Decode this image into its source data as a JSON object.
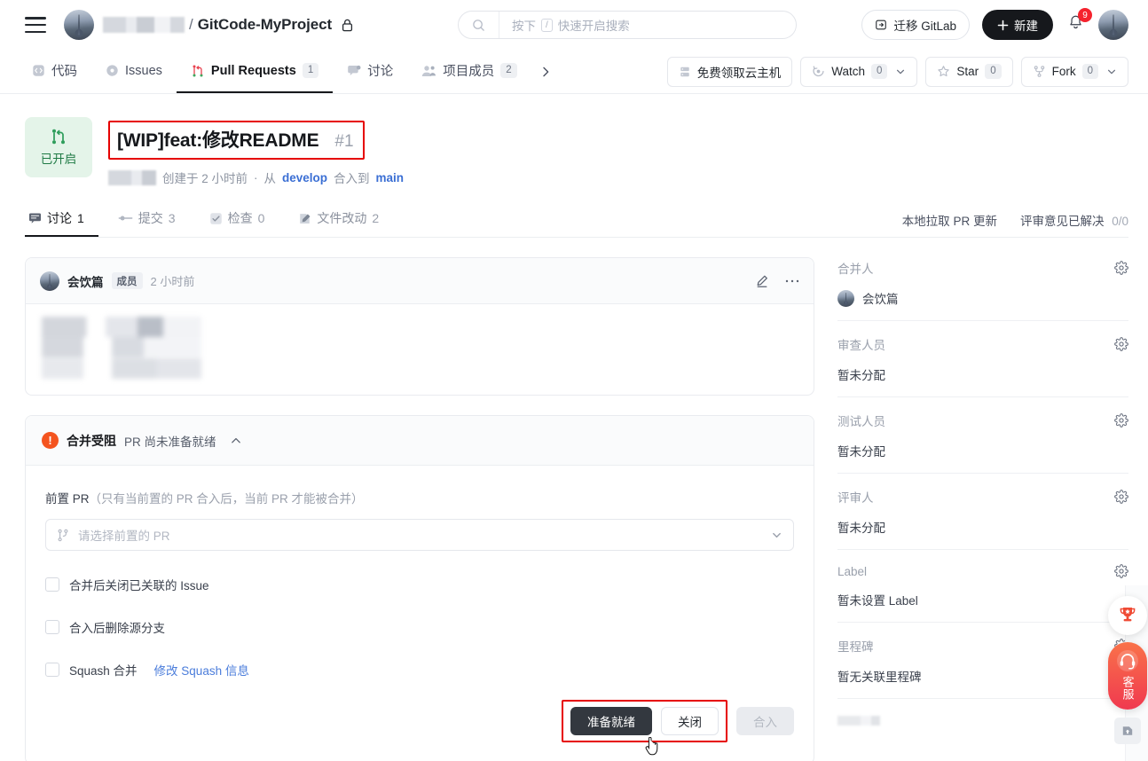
{
  "header": {
    "org_name_redacted": true,
    "repo_separator": "/",
    "repo_name": "GitCode-MyProject",
    "lock_icon": "lock-icon",
    "search": {
      "placeholder_prefix": "按下",
      "slash_key": "/",
      "placeholder_suffix": "快速开启搜索",
      "icon": "search-icon"
    },
    "migrate_gitlab_label": "迁移 GitLab",
    "new_button_label": "新建",
    "notification_count": "9",
    "avatar": "user-avatar"
  },
  "repo_nav": {
    "tabs": [
      {
        "label": "代码",
        "icon": "code-icon",
        "count": "",
        "active": false
      },
      {
        "label": "Issues",
        "icon": "issue-icon",
        "count": "",
        "active": false
      },
      {
        "label": "Pull Requests",
        "icon": "pull-request-icon",
        "count": "1",
        "active": true
      },
      {
        "label": "讨论",
        "icon": "discussion-icon",
        "count": "",
        "active": false
      },
      {
        "label": "项目成员",
        "icon": "members-icon",
        "count": "2",
        "active": false
      }
    ],
    "more_icon": "chevron-right-icon",
    "actions": [
      {
        "label": "免费领取云主机",
        "icon": "server-icon",
        "count": "",
        "caret": false
      },
      {
        "label": "Watch",
        "icon": "watch-icon",
        "count": "0",
        "caret": true
      },
      {
        "label": "Star",
        "icon": "star-icon",
        "count": "0",
        "caret": false
      },
      {
        "label": "Fork",
        "icon": "fork-icon",
        "count": "0",
        "caret": true
      }
    ]
  },
  "pr": {
    "status_label": "已开启",
    "status_icon": "pull-request-icon",
    "title": "[WIP]feat:修改README",
    "number": "#1",
    "meta": {
      "author_redacted": true,
      "created": "创建于 2 小时前",
      "separator": "·",
      "from_label": "从",
      "source_branch": "develop",
      "merge_label": "合入到",
      "target_branch": "main"
    },
    "tabs": [
      {
        "label": "讨论",
        "count": "1",
        "icon": "comment-icon",
        "active": true
      },
      {
        "label": "提交",
        "count": "3",
        "icon": "commit-icon",
        "active": false
      },
      {
        "label": "检查",
        "count": "0",
        "icon": "check-icon",
        "active": false
      },
      {
        "label": "文件改动",
        "count": "2",
        "icon": "file-diff-icon",
        "active": false
      }
    ],
    "tabs_right": [
      {
        "label": "本地拉取 PR 更新",
        "value": ""
      },
      {
        "label": "评审意见已解决",
        "value": "0/0"
      }
    ]
  },
  "comment": {
    "author": "会饮篇",
    "role_badge": "成员",
    "time": "2 小时前",
    "edit_icon": "pencil-icon",
    "more_icon": "ellipsis-icon",
    "body_redacted": true
  },
  "merge": {
    "status_title": "合并受阻",
    "status_desc": "PR 尚未准备就绪",
    "alert_icon": "exclamation-icon",
    "collapse_icon": "chevron-up-icon",
    "prereq_label": "前置 PR",
    "prereq_hint": "（只有当前置的 PR 合入后，当前 PR 才能被合并）",
    "prereq_placeholder": "请选择前置的 PR",
    "prereq_icon": "branch-icon",
    "options": [
      {
        "label": "合并后关闭已关联的 Issue",
        "checked": false,
        "link": ""
      },
      {
        "label": "合入后删除源分支",
        "checked": false,
        "link": ""
      },
      {
        "label": "Squash 合并",
        "checked": false,
        "link": "修改 Squash 信息"
      }
    ],
    "buttons": {
      "ready_label": "准备就绪",
      "close_label": "关闭",
      "merge_label": "合入"
    }
  },
  "sidebar": {
    "sections": [
      {
        "title": "合并人",
        "value": "会饮篇",
        "has_avatar": true,
        "gear": "gear-icon"
      },
      {
        "title": "审查人员",
        "value": "暂未分配",
        "has_avatar": false,
        "gear": "gear-icon"
      },
      {
        "title": "测试人员",
        "value": "暂未分配",
        "has_avatar": false,
        "gear": "gear-icon"
      },
      {
        "title": "评审人",
        "value": "暂未分配",
        "has_avatar": false,
        "gear": "gear-icon"
      },
      {
        "title": "Label",
        "value": "暂未设置 Label",
        "has_avatar": false,
        "gear": "gear-icon"
      },
      {
        "title": "里程碑",
        "value": "暂无关联里程碑",
        "has_avatar": false,
        "gear": "gear-icon"
      }
    ]
  },
  "floating": {
    "trophy_icon": "trophy-icon",
    "support_icon": "headset-icon",
    "support_label": "客服",
    "top_icon": "scroll-top-icon"
  },
  "colors": {
    "accent_red": "#e60000",
    "alert_orange": "#f4541f",
    "open_green": "#1f7a45",
    "open_green_bg": "#e4f4e9",
    "link_blue": "#3b6fd4",
    "dark_button": "#33383f",
    "badge_red": "#f5222d"
  }
}
